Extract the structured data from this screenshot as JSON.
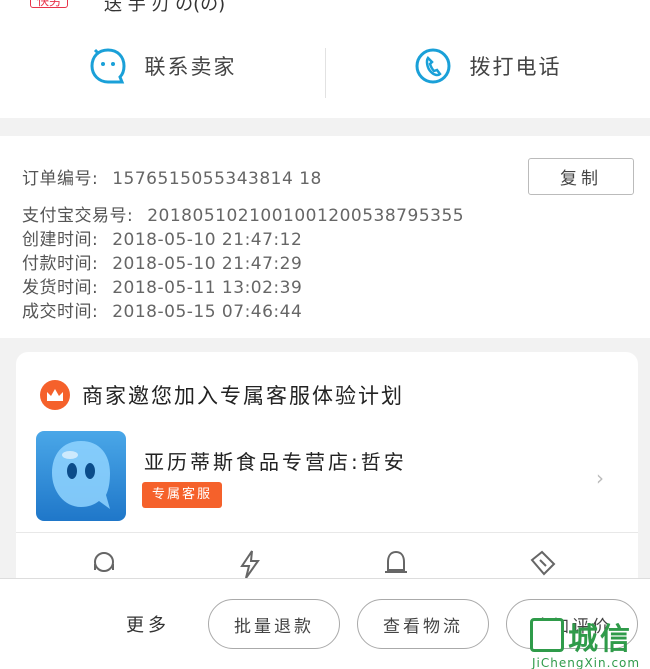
{
  "top_strip": {
    "badge": "快另",
    "cut_text": "送 手 刃 の(の)"
  },
  "contact": {
    "seller_label": "联系卖家",
    "call_label": "拨打电话"
  },
  "order_info": {
    "copy_button": "复制",
    "lines": [
      {
        "label": "订单编号:",
        "value": "1576515055343814 18"
      },
      {
        "label": "支付宝交易号:",
        "value": "2018051021001001200538795355"
      },
      {
        "label": "创建时间:",
        "value": "2018-05-10  21:47:12"
      },
      {
        "label": "付款时间:",
        "value": "2018-05-10  21:47:29"
      },
      {
        "label": "发货时间:",
        "value": "2018-05-11  13:02:39"
      },
      {
        "label": "成交时间:",
        "value": "2018-05-15  07:46:44"
      }
    ]
  },
  "service_card": {
    "title": "商家邀您加入专属客服体验计划",
    "store_name": "亚历蒂斯食品专营店:哲安",
    "store_tag": "专属客服",
    "icons": [
      "headset-icon",
      "lightning-icon",
      "bell-icon",
      "ticket-icon"
    ]
  },
  "bottom_bar": {
    "more": "更多",
    "batch_refund": "批量退款",
    "view_logistics": "查看物流",
    "add_review": "追加评价"
  },
  "watermark": {
    "text": "城信",
    "url": "JiChengXin.com"
  },
  "colors": {
    "accent": "#f5612b",
    "icon_blue": "#1aa0d8",
    "watermark_green": "#2f9b4a"
  }
}
